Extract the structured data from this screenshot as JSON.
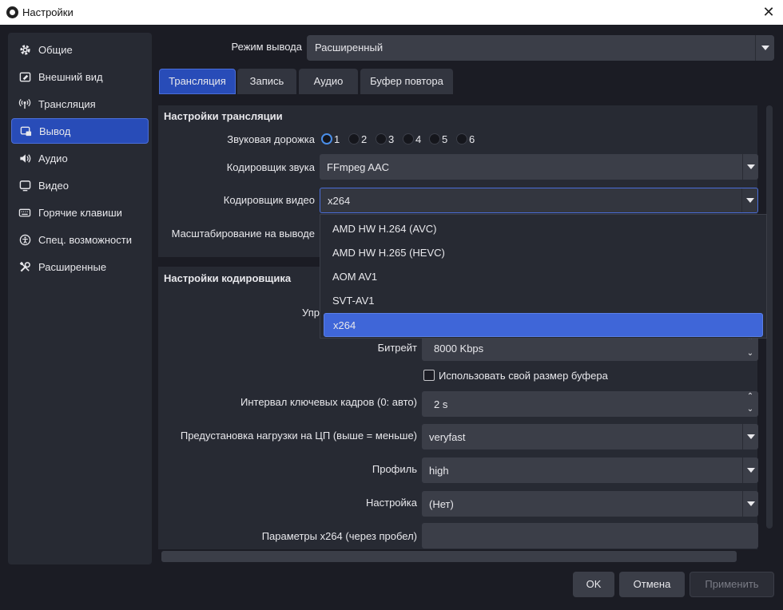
{
  "window": {
    "title": "Настройки",
    "close_glyph": "✕"
  },
  "sidebar": {
    "items": [
      {
        "label": "Общие",
        "icon": "gear-icon"
      },
      {
        "label": "Внешний вид",
        "icon": "appearance-icon"
      },
      {
        "label": "Трансляция",
        "icon": "broadcast-icon"
      },
      {
        "label": "Вывод",
        "icon": "output-icon",
        "active": true
      },
      {
        "label": "Аудио",
        "icon": "speaker-icon"
      },
      {
        "label": "Видео",
        "icon": "monitor-icon"
      },
      {
        "label": "Горячие клавиши",
        "icon": "keyboard-icon"
      },
      {
        "label": "Спец. возможности",
        "icon": "accessibility-icon"
      },
      {
        "label": "Расширенные",
        "icon": "tools-icon"
      }
    ]
  },
  "output_mode": {
    "label": "Режим вывода",
    "value": "Расширенный"
  },
  "tabs": [
    {
      "label": "Трансляция",
      "active": true
    },
    {
      "label": "Запись"
    },
    {
      "label": "Аудио"
    },
    {
      "label": "Буфер повтора"
    }
  ],
  "stream_settings": {
    "title": "Настройки трансляции",
    "audio_track": {
      "label": "Звуковая дорожка",
      "options": [
        "1",
        "2",
        "3",
        "4",
        "5",
        "6"
      ],
      "selected": "1"
    },
    "audio_encoder": {
      "label": "Кодировщик звука",
      "value": "FFmpeg AAC"
    },
    "video_encoder": {
      "label": "Кодировщик видео",
      "value": "x264"
    },
    "rescale": {
      "label": "Масштабирование на выводе"
    }
  },
  "encoder_dropdown": {
    "options": [
      "AMD HW H.264 (AVC)",
      "AMD HW H.265 (HEVC)",
      "AOM AV1",
      "SVT-AV1",
      "x264"
    ],
    "selected": "x264"
  },
  "encoder_settings": {
    "title": "Настройки кодировщика",
    "rate_control_partial": "Упр",
    "bitrate": {
      "label": "Битрейт",
      "value": "8000 Kbps"
    },
    "custom_buffer": {
      "label": "Использовать свой размер буфера",
      "checked": false
    },
    "keyframe": {
      "label": "Интервал ключевых кадров (0: авто)",
      "value": "2 s"
    },
    "cpu_preset": {
      "label": "Предустановка нагрузки на ЦП (выше = меньше)",
      "value": "veryfast"
    },
    "profile": {
      "label": "Профиль",
      "value": "high"
    },
    "tune": {
      "label": "Настройка",
      "value": "(Нет)"
    },
    "x264_opts": {
      "label": "Параметры x264 (через пробел)",
      "value": ""
    }
  },
  "buttons": {
    "ok": "OK",
    "cancel": "Отмена",
    "apply": "Применить"
  },
  "colors": {
    "accent": "#284cb8",
    "background": "#1b1c24",
    "panel": "#272a33"
  }
}
